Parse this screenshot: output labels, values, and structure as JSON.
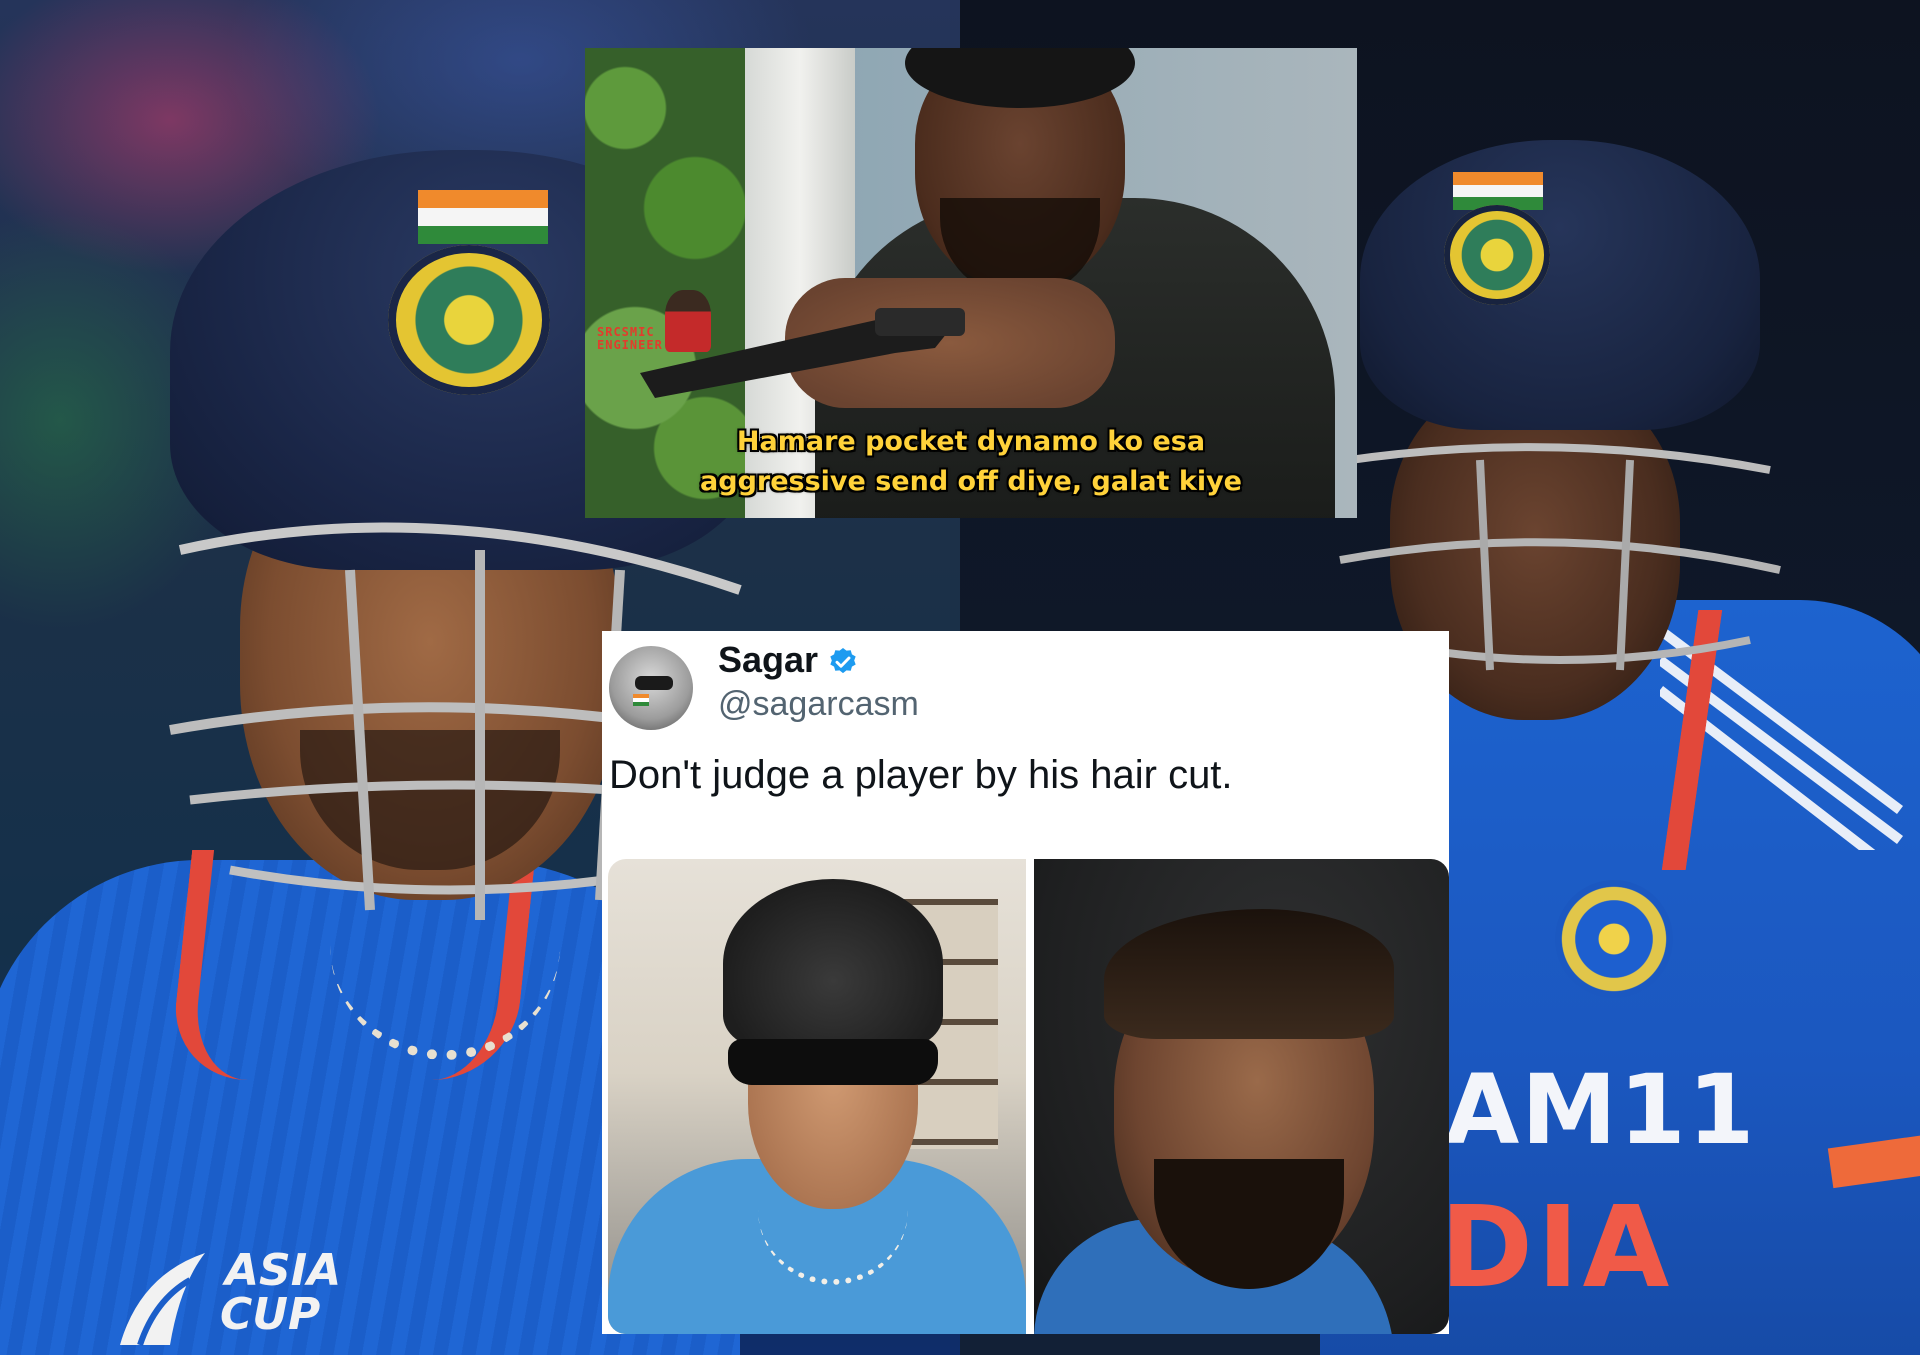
{
  "meme": {
    "caption_line1": "Hamare pocket dynamo ko esa",
    "caption_line2": "aggressive send off diye, galat kiye",
    "watermark_line1": "SRCSMIC",
    "watermark_line2": "ENGINEER"
  },
  "tweet": {
    "name": "Sagar",
    "handle": "@sagarcasm",
    "text": "Don't judge a player by his hair cut."
  },
  "background": {
    "left_logo_line1": "ASIA",
    "left_logo_line2": "CUP",
    "right_jersey_line1": "AM11",
    "right_jersey_line2": "DIA"
  },
  "colors": {
    "verified_badge": "#1d9bf0",
    "caption_yellow": "#ffd23a",
    "jersey_blue": "#1e5fc8"
  }
}
